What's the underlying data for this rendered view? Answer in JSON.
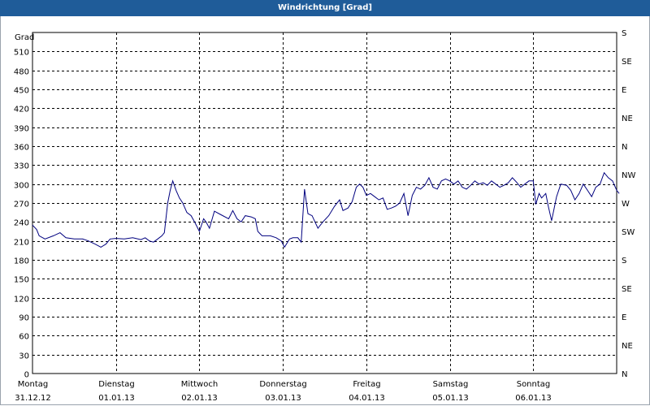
{
  "window": {
    "title": "Windrichtung [Grad]"
  },
  "colors": {
    "titlebar": "#1f5c99",
    "line": "#00007f",
    "grid": "#000000"
  },
  "chart_data": {
    "type": "line",
    "title": "Windrichtung [Grad]",
    "ylabel": "Grad",
    "ylim": [
      0,
      540
    ],
    "y_ticks": [
      0,
      30,
      60,
      90,
      120,
      150,
      180,
      210,
      240,
      270,
      300,
      330,
      360,
      390,
      420,
      450,
      480,
      510
    ],
    "y2_ticks": [
      {
        "value": 0,
        "label": "N"
      },
      {
        "value": 45,
        "label": "NE"
      },
      {
        "value": 90,
        "label": "E"
      },
      {
        "value": 135,
        "label": "SE"
      },
      {
        "value": 180,
        "label": "S"
      },
      {
        "value": 225,
        "label": "SW"
      },
      {
        "value": 270,
        "label": "W"
      },
      {
        "value": 315,
        "label": "NW"
      },
      {
        "value": 360,
        "label": "N"
      },
      {
        "value": 405,
        "label": "NE"
      },
      {
        "value": 450,
        "label": "E"
      },
      {
        "value": 495,
        "label": "SE"
      },
      {
        "value": 540,
        "label": "S"
      }
    ],
    "xlim": [
      0,
      7
    ],
    "x_ticks": [
      {
        "x": 0,
        "day": "Montag",
        "date": "31.12.12"
      },
      {
        "x": 1,
        "day": "Dienstag",
        "date": "01.01.13"
      },
      {
        "x": 2,
        "day": "Mittwoch",
        "date": "02.01.13"
      },
      {
        "x": 3,
        "day": "Donnerstag",
        "date": "03.01.13"
      },
      {
        "x": 4,
        "day": "Freitag",
        "date": "04.01.13"
      },
      {
        "x": 5,
        "day": "Samstag",
        "date": "05.01.13"
      },
      {
        "x": 6,
        "day": "Sonntag",
        "date": "06.01.13"
      }
    ],
    "grid": true,
    "series": [
      {
        "points": [
          [
            0.0,
            235
          ],
          [
            0.05,
            228
          ],
          [
            0.08,
            218
          ],
          [
            0.15,
            213
          ],
          [
            0.25,
            218
          ],
          [
            0.33,
            223
          ],
          [
            0.4,
            215
          ],
          [
            0.5,
            213
          ],
          [
            0.6,
            213
          ],
          [
            0.67,
            210
          ],
          [
            0.75,
            205
          ],
          [
            0.82,
            200
          ],
          [
            0.88,
            205
          ],
          [
            0.93,
            213
          ],
          [
            1.0,
            214
          ],
          [
            1.1,
            213
          ],
          [
            1.2,
            215
          ],
          [
            1.3,
            212
          ],
          [
            1.35,
            215
          ],
          [
            1.4,
            210
          ],
          [
            1.45,
            208
          ],
          [
            1.5,
            213
          ],
          [
            1.55,
            218
          ],
          [
            1.58,
            223
          ],
          [
            1.62,
            270
          ],
          [
            1.65,
            290
          ],
          [
            1.68,
            305
          ],
          [
            1.72,
            290
          ],
          [
            1.76,
            278
          ],
          [
            1.8,
            270
          ],
          [
            1.85,
            255
          ],
          [
            1.9,
            250
          ],
          [
            1.95,
            238
          ],
          [
            2.0,
            225
          ],
          [
            2.05,
            245
          ],
          [
            2.08,
            240
          ],
          [
            2.12,
            230
          ],
          [
            2.18,
            257
          ],
          [
            2.25,
            252
          ],
          [
            2.35,
            245
          ],
          [
            2.4,
            258
          ],
          [
            2.45,
            245
          ],
          [
            2.5,
            240
          ],
          [
            2.55,
            250
          ],
          [
            2.62,
            248
          ],
          [
            2.67,
            245
          ],
          [
            2.7,
            225
          ],
          [
            2.75,
            218
          ],
          [
            2.85,
            218
          ],
          [
            2.92,
            215
          ],
          [
            2.98,
            210
          ],
          [
            3.02,
            200
          ],
          [
            3.08,
            213
          ],
          [
            3.12,
            215
          ],
          [
            3.18,
            215
          ],
          [
            3.22,
            208
          ],
          [
            3.26,
            292
          ],
          [
            3.3,
            253
          ],
          [
            3.35,
            250
          ],
          [
            3.42,
            230
          ],
          [
            3.48,
            240
          ],
          [
            3.55,
            250
          ],
          [
            3.62,
            265
          ],
          [
            3.68,
            275
          ],
          [
            3.72,
            258
          ],
          [
            3.78,
            262
          ],
          [
            3.83,
            272
          ],
          [
            3.88,
            295
          ],
          [
            3.92,
            300
          ],
          [
            3.96,
            295
          ],
          [
            4.0,
            282
          ],
          [
            4.05,
            285
          ],
          [
            4.1,
            280
          ],
          [
            4.15,
            275
          ],
          [
            4.2,
            278
          ],
          [
            4.25,
            260
          ],
          [
            4.3,
            262
          ],
          [
            4.35,
            265
          ],
          [
            4.4,
            270
          ],
          [
            4.45,
            285
          ],
          [
            4.5,
            250
          ],
          [
            4.55,
            282
          ],
          [
            4.6,
            295
          ],
          [
            4.65,
            292
          ],
          [
            4.7,
            298
          ],
          [
            4.75,
            310
          ],
          [
            4.8,
            295
          ],
          [
            4.85,
            292
          ],
          [
            4.9,
            305
          ],
          [
            4.95,
            308
          ],
          [
            5.0,
            305
          ],
          [
            5.05,
            300
          ],
          [
            5.1,
            305
          ],
          [
            5.15,
            295
          ],
          [
            5.2,
            292
          ],
          [
            5.25,
            298
          ],
          [
            5.3,
            305
          ],
          [
            5.35,
            300
          ],
          [
            5.4,
            302
          ],
          [
            5.45,
            298
          ],
          [
            5.5,
            305
          ],
          [
            5.55,
            300
          ],
          [
            5.6,
            295
          ],
          [
            5.65,
            298
          ],
          [
            5.7,
            302
          ],
          [
            5.75,
            310
          ],
          [
            5.8,
            303
          ],
          [
            5.85,
            295
          ],
          [
            5.9,
            300
          ],
          [
            5.95,
            305
          ],
          [
            6.0,
            305
          ],
          [
            6.03,
            268
          ],
          [
            6.07,
            285
          ],
          [
            6.1,
            278
          ],
          [
            6.15,
            285
          ],
          [
            6.18,
            265
          ],
          [
            6.22,
            242
          ],
          [
            6.28,
            280
          ],
          [
            6.33,
            300
          ],
          [
            6.4,
            298
          ],
          [
            6.45,
            290
          ],
          [
            6.5,
            275
          ],
          [
            6.55,
            285
          ],
          [
            6.6,
            300
          ],
          [
            6.65,
            290
          ],
          [
            6.7,
            280
          ],
          [
            6.75,
            295
          ],
          [
            6.8,
            300
          ],
          [
            6.85,
            318
          ],
          [
            6.9,
            310
          ],
          [
            6.95,
            305
          ],
          [
            7.0,
            290
          ],
          [
            7.03,
            285
          ]
        ]
      }
    ]
  }
}
